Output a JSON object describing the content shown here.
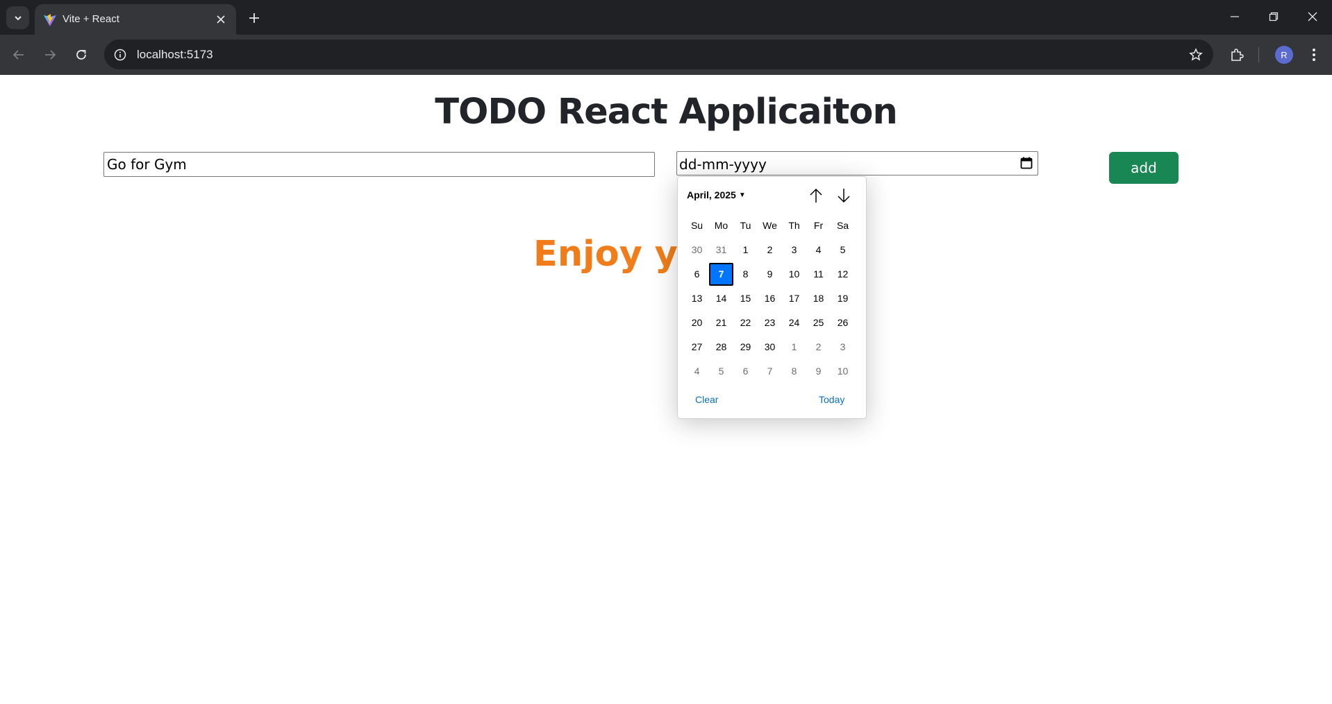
{
  "browser": {
    "tab_title": "Vite + React",
    "url": "localhost:5173",
    "avatar_initial": "R"
  },
  "page": {
    "title": "TODO React Applicaiton",
    "todo_input_value": "Go for Gym",
    "date_placeholder": "dd-mm-yyyy",
    "add_label": "add",
    "welcome_text": "Enjoy you"
  },
  "datepicker": {
    "month_label": "April, 2025",
    "weekdays": [
      "Su",
      "Mo",
      "Tu",
      "We",
      "Th",
      "Fr",
      "Sa"
    ],
    "weeks": [
      [
        {
          "d": "30",
          "m": true
        },
        {
          "d": "31",
          "m": true
        },
        {
          "d": "1"
        },
        {
          "d": "2"
        },
        {
          "d": "3"
        },
        {
          "d": "4"
        },
        {
          "d": "5"
        }
      ],
      [
        {
          "d": "6"
        },
        {
          "d": "7",
          "sel": true
        },
        {
          "d": "8"
        },
        {
          "d": "9"
        },
        {
          "d": "10"
        },
        {
          "d": "11"
        },
        {
          "d": "12"
        }
      ],
      [
        {
          "d": "13"
        },
        {
          "d": "14"
        },
        {
          "d": "15"
        },
        {
          "d": "16"
        },
        {
          "d": "17"
        },
        {
          "d": "18"
        },
        {
          "d": "19"
        }
      ],
      [
        {
          "d": "20"
        },
        {
          "d": "21"
        },
        {
          "d": "22"
        },
        {
          "d": "23"
        },
        {
          "d": "24"
        },
        {
          "d": "25"
        },
        {
          "d": "26"
        }
      ],
      [
        {
          "d": "27"
        },
        {
          "d": "28"
        },
        {
          "d": "29"
        },
        {
          "d": "30"
        },
        {
          "d": "1",
          "m": true
        },
        {
          "d": "2",
          "m": true
        },
        {
          "d": "3",
          "m": true
        }
      ],
      [
        {
          "d": "4",
          "m": true
        },
        {
          "d": "5",
          "m": true
        },
        {
          "d": "6",
          "m": true
        },
        {
          "d": "7",
          "m": true
        },
        {
          "d": "8",
          "m": true
        },
        {
          "d": "9",
          "m": true
        },
        {
          "d": "10",
          "m": true
        }
      ]
    ],
    "clear_label": "Clear",
    "today_label": "Today"
  }
}
